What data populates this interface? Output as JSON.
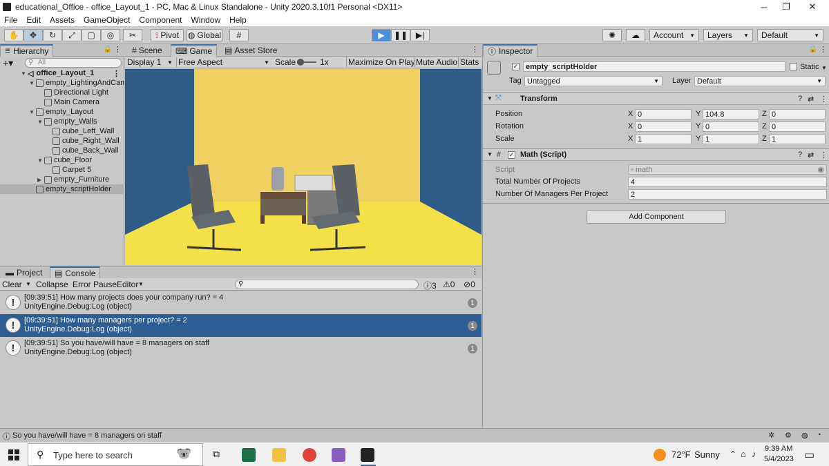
{
  "window": {
    "title": "educational_Office - office_Layout_1 - PC, Mac & Linux Standalone - Unity 2020.3.10f1 Personal <DX11>",
    "minimize": "─",
    "maximize": "❐",
    "close": "✕"
  },
  "menu": [
    "File",
    "Edit",
    "Assets",
    "GameObject",
    "Component",
    "Window",
    "Help"
  ],
  "toolbar": {
    "pivot": "Pivot",
    "global": "Global",
    "account": "Account",
    "layers": "Layers",
    "layout": "Default"
  },
  "hierarchy": {
    "tab": "Hierarchy",
    "search_placeholder": "All",
    "scene": "office_Layout_1",
    "items": [
      {
        "label": "empty_LightingAndCam",
        "depth": 1,
        "expanded": true
      },
      {
        "label": "Directional Light",
        "depth": 2
      },
      {
        "label": "Main Camera",
        "depth": 2
      },
      {
        "label": "empty_Layout",
        "depth": 1,
        "expanded": true
      },
      {
        "label": "empty_Walls",
        "depth": 2,
        "expanded": true
      },
      {
        "label": "cube_Left_Wall",
        "depth": 3
      },
      {
        "label": "cube_Right_Wall",
        "depth": 3
      },
      {
        "label": "cube_Back_Wall",
        "depth": 3
      },
      {
        "label": "cube_Floor",
        "depth": 2,
        "expanded": true
      },
      {
        "label": "Carpet 5",
        "depth": 3
      },
      {
        "label": "empty_Furniture",
        "depth": 2,
        "collapsed": true
      },
      {
        "label": "empty_scriptHolder",
        "depth": 1,
        "selected": true
      }
    ]
  },
  "game": {
    "tabs": [
      "Scene",
      "Game",
      "Asset Store"
    ],
    "display": "Display 1",
    "aspect": "Free Aspect",
    "scale_label": "Scale",
    "scale_value": "1x",
    "maximize": "Maximize On Play",
    "mute": "Mute Audio",
    "stats": "Stats"
  },
  "inspector": {
    "tab": "Inspector",
    "object_name": "empty_scriptHolder",
    "static_label": "Static",
    "tag_label": "Tag",
    "tag_value": "Untagged",
    "layer_label": "Layer",
    "layer_value": "Default",
    "transform": {
      "title": "Transform",
      "rows": [
        {
          "label": "Position",
          "x": "0",
          "y": "104.8",
          "z": "0"
        },
        {
          "label": "Rotation",
          "x": "0",
          "y": "0",
          "z": "0"
        },
        {
          "label": "Scale",
          "x": "1",
          "y": "1",
          "z": "1"
        }
      ]
    },
    "script": {
      "title": "Math (Script)",
      "script_label": "Script",
      "script_value": "math",
      "fields": [
        {
          "label": "Total Number Of Projects",
          "value": "4"
        },
        {
          "label": "Number Of Managers Per Project",
          "value": "2"
        }
      ]
    },
    "add_component": "Add Component"
  },
  "console": {
    "tabs": [
      "Project",
      "Console"
    ],
    "clear": "Clear",
    "collapse": "Collapse",
    "error_pause": "Error Pause",
    "editor": "Editor",
    "counts": {
      "log": "3",
      "warn": "0",
      "error": "0"
    },
    "logs": [
      {
        "line1": "[09:39:51] How many projects does your company run? = 4",
        "line2": "UnityEngine.Debug:Log (object)",
        "count": "1"
      },
      {
        "line1": "[09:39:51] How many managers per project? = 2",
        "line2": "UnityEngine.Debug:Log (object)",
        "count": "1",
        "selected": true
      },
      {
        "line1": "[09:39:51] So you have/will have = 8 managers on staff",
        "line2": "UnityEngine.Debug:Log (object)",
        "count": "1"
      }
    ]
  },
  "statusbar": {
    "message": "So you have/will have = 8 managers on staff"
  },
  "taskbar": {
    "search_placeholder": "Type here to search",
    "weather_temp": "72°F",
    "weather_desc": "Sunny",
    "time": "9:39 AM",
    "date": "5/4/2023"
  },
  "colors": {
    "selection": "#2c5d93",
    "hier_selected": "#b0b0b0",
    "wall_yellow": "#f0d060",
    "floor_yellow": "#f4e048",
    "side_blue": "#2f5b87"
  }
}
